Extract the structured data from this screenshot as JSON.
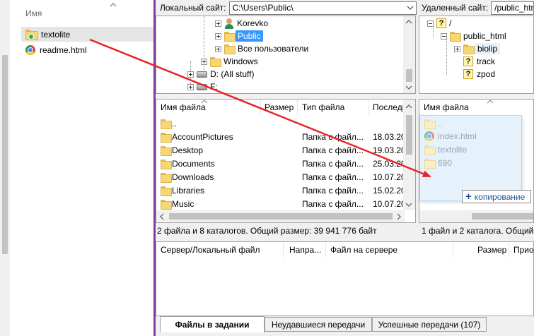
{
  "left_panel": {
    "header": "Имя",
    "items": [
      {
        "name": "textolite",
        "icon": "synced-folder-icon"
      },
      {
        "name": "readme.html",
        "icon": "chrome-html-icon"
      }
    ]
  },
  "local": {
    "site_label": "Локальный сайт:",
    "site_path": "C:\\Users\\Public\\",
    "tree": [
      {
        "label": "Korevko",
        "icon": "user-icon"
      },
      {
        "label": "Public",
        "icon": "folder-icon",
        "selected": true
      },
      {
        "label": "Все пользователи",
        "icon": "folder-icon"
      },
      {
        "label": "Windows",
        "icon": "folder-icon"
      },
      {
        "label": "D: (All stuff)",
        "icon": "drive-icon"
      },
      {
        "label": "F:",
        "icon": "drive-icon"
      }
    ],
    "columns": [
      "Имя файла",
      "Размер",
      "Тип файла",
      "Последн"
    ],
    "files": [
      {
        "name": "..",
        "size": "",
        "type": "",
        "modified": ""
      },
      {
        "name": "AccountPictures",
        "size": "",
        "type": "Папка с файл...",
        "modified": "18.03.20"
      },
      {
        "name": "Desktop",
        "size": "",
        "type": "Папка с файл...",
        "modified": "19.03.20"
      },
      {
        "name": "Documents",
        "size": "",
        "type": "Папка с файл...",
        "modified": "25.03.20"
      },
      {
        "name": "Downloads",
        "size": "",
        "type": "Папка с файл...",
        "modified": "10.07.20"
      },
      {
        "name": "Libraries",
        "size": "",
        "type": "Папка с файл...",
        "modified": "15.02.20"
      },
      {
        "name": "Music",
        "size": "",
        "type": "Папка с файл...",
        "modified": "10.07.20"
      }
    ],
    "status": "2 файла и 8 каталогов. Общий размер: 39 941 776 байт"
  },
  "remote": {
    "site_label": "Удаленный сайт:",
    "site_path": "/public_html",
    "tree": [
      {
        "label": "/",
        "icon": "unknown-folder-icon"
      },
      {
        "label": "public_html",
        "icon": "folder-icon"
      },
      {
        "label": "biolip",
        "icon": "folder-icon",
        "highlight": true
      },
      {
        "label": "track",
        "icon": "unknown-folder-icon"
      },
      {
        "label": "zpod",
        "icon": "unknown-folder-icon"
      }
    ],
    "columns": [
      "Имя файла"
    ],
    "status": "1 файл и 2 каталога. Общий"
  },
  "drag_ghost": {
    "items": [
      {
        "name": "..",
        "icon": "folder-icon"
      },
      {
        "name": "index.html",
        "icon": "chrome-html-icon"
      },
      {
        "name": "textolite",
        "icon": "folder-icon"
      },
      {
        "name": "690",
        "icon": "folder-icon"
      }
    ],
    "tooltip": "копирование"
  },
  "queue": {
    "columns": [
      "Сервер/Локальный файл",
      "Напра...",
      "Файл на сервере",
      "Размер",
      "Прио"
    ],
    "tabs": [
      "Файлы в задании",
      "Неудавшиеся передачи",
      "Успешные передачи (107)"
    ],
    "active_tab": 0
  },
  "colors": {
    "arrow": "#e8232a",
    "selection": "#3399ff",
    "window_border": "#7c3fa0",
    "folder": "#f7d774"
  }
}
